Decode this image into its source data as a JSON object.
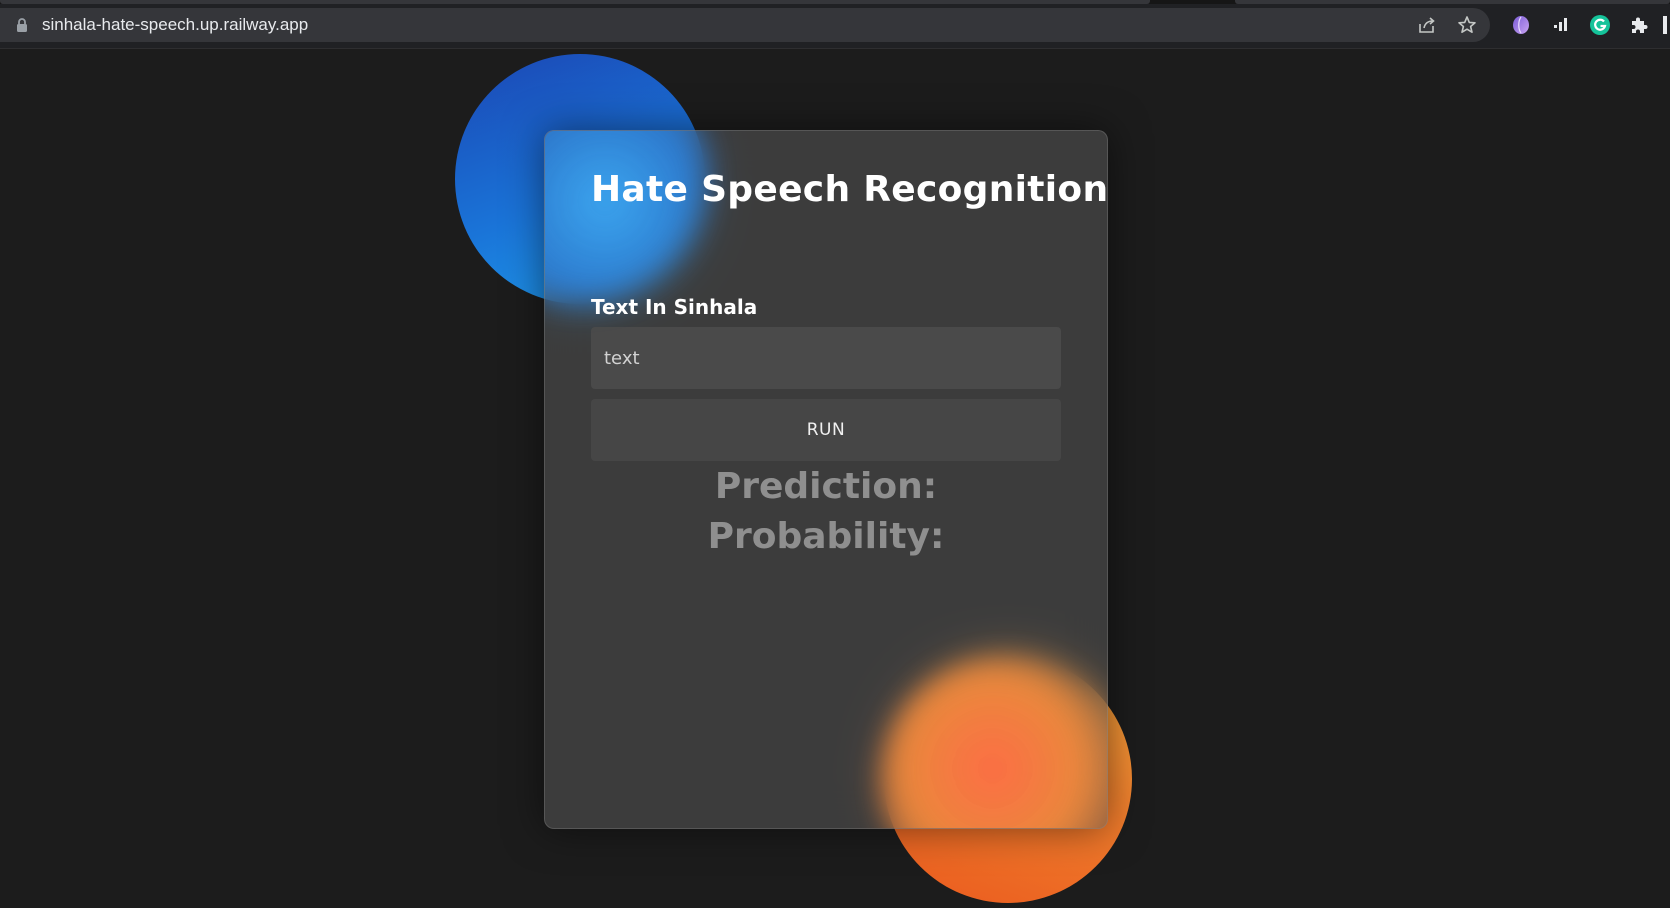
{
  "browser": {
    "url": "sinhala-hate-speech.up.railway.app",
    "icons": [
      "lock-icon",
      "share-icon",
      "star-icon",
      "extension-purple-icon",
      "signal-icon",
      "grammarly-icon",
      "puzzle-icon"
    ]
  },
  "app": {
    "title": "Hate Speech Recognition",
    "input_label": "Text In Sinhala",
    "input_placeholder": "text",
    "run_label": "RUN",
    "prediction_label": "Prediction:",
    "probability_label": "Probability:",
    "colors": {
      "background": "#1c1c1c",
      "blue_blob": "#1a74d8",
      "orange_blob": "#f07c2c"
    }
  }
}
